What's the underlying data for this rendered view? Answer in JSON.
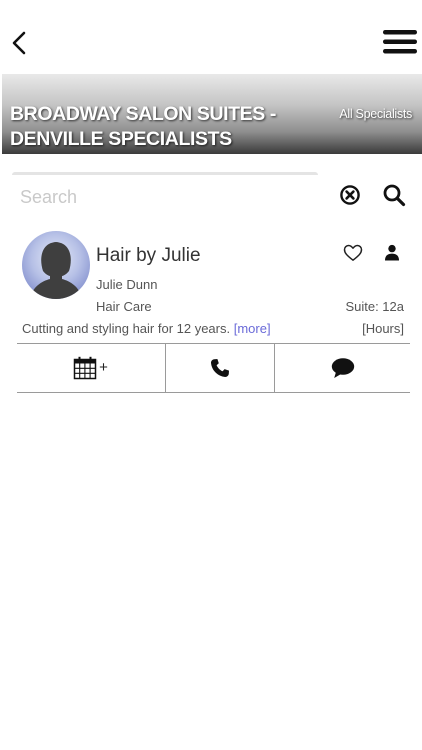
{
  "header": {
    "back_icon": "chevron-left-icon",
    "menu_icon": "hamburger-menu-icon"
  },
  "banner": {
    "title_line1": "BROADWAY SALON SUITES -",
    "title_line2": "DENVILLE SPECIALISTS",
    "all_link": "All Specialists"
  },
  "search": {
    "placeholder": "Search",
    "value": "",
    "clear_icon": "clear-circle-icon",
    "search_icon": "magnifier-icon"
  },
  "specialist": {
    "name": "Hair by Julie",
    "person": "Julie Dunn",
    "category": "Hair Care",
    "suite": "Suite: 12a",
    "description": "Cutting and styling hair for 12 years.",
    "more_label": "[more]",
    "hours_label": "[Hours]",
    "favorite_icon": "heart-outline-icon",
    "profile_icon": "person-icon"
  },
  "actions": {
    "book_plus": "+",
    "book_icon": "calendar-icon",
    "call_icon": "phone-icon",
    "message_icon": "chat-bubble-icon"
  },
  "colors": {
    "link": "#6a6ad8",
    "text": "#555555",
    "divider": "#9a9a9a"
  }
}
